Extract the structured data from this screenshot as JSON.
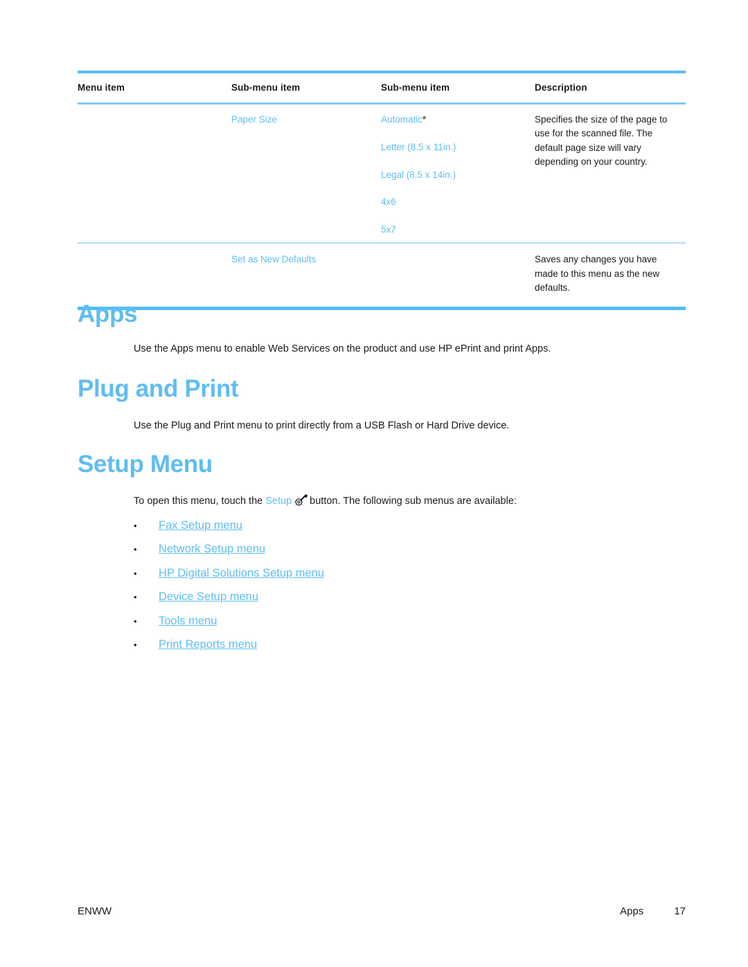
{
  "colors": {
    "accent_blue": "#5fbdf2",
    "rule_blue": "#54bdf5",
    "rule_blue_light": "#aedcf8",
    "text": "#1a1a1a"
  },
  "table": {
    "headers": [
      "Menu item",
      "Sub-menu item",
      "Sub-menu item",
      "Description"
    ],
    "rows": [
      {
        "menu_item": "",
        "sub_menu_item": "Paper Size",
        "sub_menu_options": [
          {
            "label": "Automatic",
            "default_marker": "*"
          },
          {
            "label": "Letter (8.5 x 11in.)",
            "default_marker": ""
          },
          {
            "label": "Legal (8.5 x 14in.)",
            "default_marker": ""
          },
          {
            "label": "4x6",
            "default_marker": ""
          },
          {
            "label": "5x7",
            "default_marker": ""
          }
        ],
        "description": "Specifies the size of the page to use for the scanned file. The default page size will vary depending on your country."
      },
      {
        "menu_item": "",
        "sub_menu_item": "Set as New Defaults",
        "sub_menu_options": [],
        "description": "Saves any changes you have made to this menu as the new defaults."
      }
    ]
  },
  "sections": [
    {
      "id": "apps",
      "heading": "Apps",
      "paragraph": "Use the Apps menu to enable Web Services on the product and use HP ePrint and print Apps."
    },
    {
      "id": "plug",
      "heading": "Plug and Print",
      "paragraph": "Use the Plug and Print menu to print directly from a USB Flash or Hard Drive device."
    },
    {
      "id": "setup",
      "heading": "Setup Menu",
      "paragraph_before_link": "To open this menu, touch the ",
      "paragraph_link": "Setup",
      "icon_name": "setup-wrench-gear-icon",
      "paragraph_after_icon": "button. The following sub menus are available:"
    }
  ],
  "setup_submenu_links": [
    {
      "label": "Fax Setup menu"
    },
    {
      "label": "Network Setup menu"
    },
    {
      "label": "HP Digital Solutions Setup menu"
    },
    {
      "label": "Device Setup menu"
    },
    {
      "label": "Tools menu"
    },
    {
      "label": "Print Reports menu"
    }
  ],
  "footer": {
    "left": "ENWW",
    "section": "Apps",
    "page_number": "17"
  }
}
